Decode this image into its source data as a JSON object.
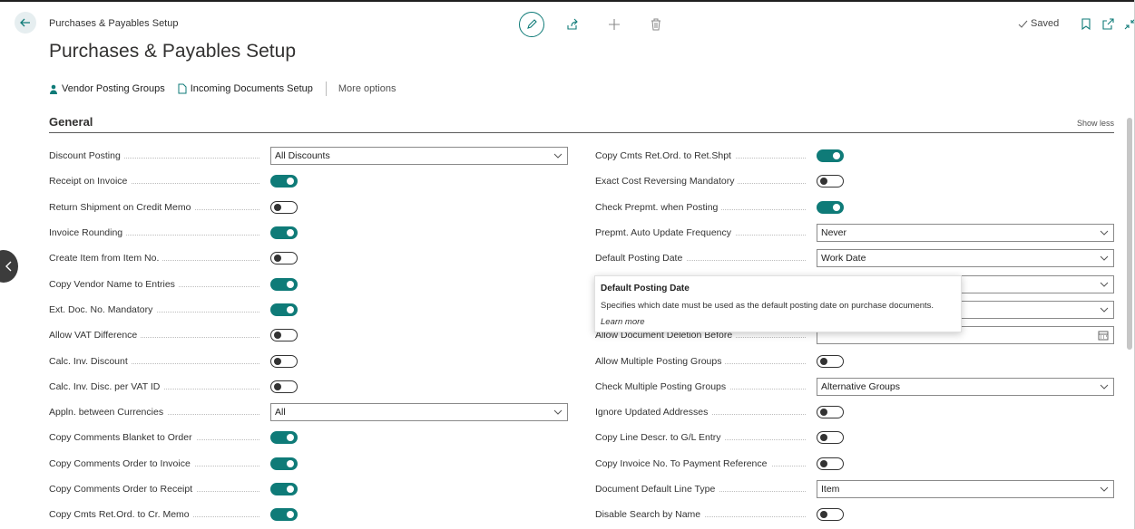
{
  "breadcrumb": "Purchases & Payables Setup",
  "page_title": "Purchases & Payables Setup",
  "status": "Saved",
  "actions": {
    "vendor_posting_groups": "Vendor Posting Groups",
    "incoming_documents_setup": "Incoming Documents Setup",
    "more_options": "More options"
  },
  "section": {
    "title": "General",
    "toggle_label": "Show less"
  },
  "colors": {
    "accent": "#0f7b78",
    "toggle_off": "#333333"
  },
  "left_fields": [
    {
      "label": "Discount Posting",
      "type": "select",
      "value": "All Discounts"
    },
    {
      "label": "Receipt on Invoice",
      "type": "toggle",
      "value": true
    },
    {
      "label": "Return Shipment on Credit Memo",
      "type": "toggle",
      "value": false
    },
    {
      "label": "Invoice Rounding",
      "type": "toggle",
      "value": true
    },
    {
      "label": "Create Item from Item No.",
      "type": "toggle",
      "value": false
    },
    {
      "label": "Copy Vendor Name to Entries",
      "type": "toggle",
      "value": true
    },
    {
      "label": "Ext. Doc. No. Mandatory",
      "type": "toggle",
      "value": true
    },
    {
      "label": "Allow VAT Difference",
      "type": "toggle",
      "value": false
    },
    {
      "label": "Calc. Inv. Discount",
      "type": "toggle",
      "value": false
    },
    {
      "label": "Calc. Inv. Disc. per VAT ID",
      "type": "toggle",
      "value": false
    },
    {
      "label": "Appln. between Currencies",
      "type": "select",
      "value": "All"
    },
    {
      "label": "Copy Comments Blanket to Order",
      "type": "toggle",
      "value": true
    },
    {
      "label": "Copy Comments Order to Invoice",
      "type": "toggle",
      "value": true
    },
    {
      "label": "Copy Comments Order to Receipt",
      "type": "toggle",
      "value": true
    },
    {
      "label": "Copy Cmts Ret.Ord. to Cr. Memo",
      "type": "toggle",
      "value": true
    }
  ],
  "right_fields": [
    {
      "label": "Copy Cmts Ret.Ord. to Ret.Shpt",
      "type": "toggle",
      "value": true
    },
    {
      "label": "Exact Cost Reversing Mandatory",
      "type": "toggle",
      "value": false
    },
    {
      "label": "Check Prepmt. when Posting",
      "type": "toggle",
      "value": true
    },
    {
      "label": "Prepmt. Auto Update Frequency",
      "type": "select",
      "value": "Never"
    },
    {
      "label": "Default Posting Date",
      "type": "select",
      "value": "Work Date"
    },
    {
      "label": "",
      "type": "select",
      "value": ""
    },
    {
      "label": "",
      "type": "select",
      "value": ""
    },
    {
      "label": "Allow Document Deletion Before",
      "type": "date",
      "value": ""
    },
    {
      "label": "Allow Multiple Posting Groups",
      "type": "toggle",
      "value": false
    },
    {
      "label": "Check Multiple Posting Groups",
      "type": "select",
      "value": "Alternative Groups"
    },
    {
      "label": "Ignore Updated Addresses",
      "type": "toggle",
      "value": false
    },
    {
      "label": "Copy Line Descr. to G/L Entry",
      "type": "toggle",
      "value": false
    },
    {
      "label": "Copy Invoice No. To Payment Reference",
      "type": "toggle",
      "value": false
    },
    {
      "label": "Document Default Line Type",
      "type": "select",
      "value": "Item"
    },
    {
      "label": "Disable Search by Name",
      "type": "toggle",
      "value": false
    }
  ],
  "tooltip": {
    "title": "Default Posting Date",
    "body": "Specifies which date must be used as the default posting date on purchase documents.",
    "link": "Learn more"
  }
}
